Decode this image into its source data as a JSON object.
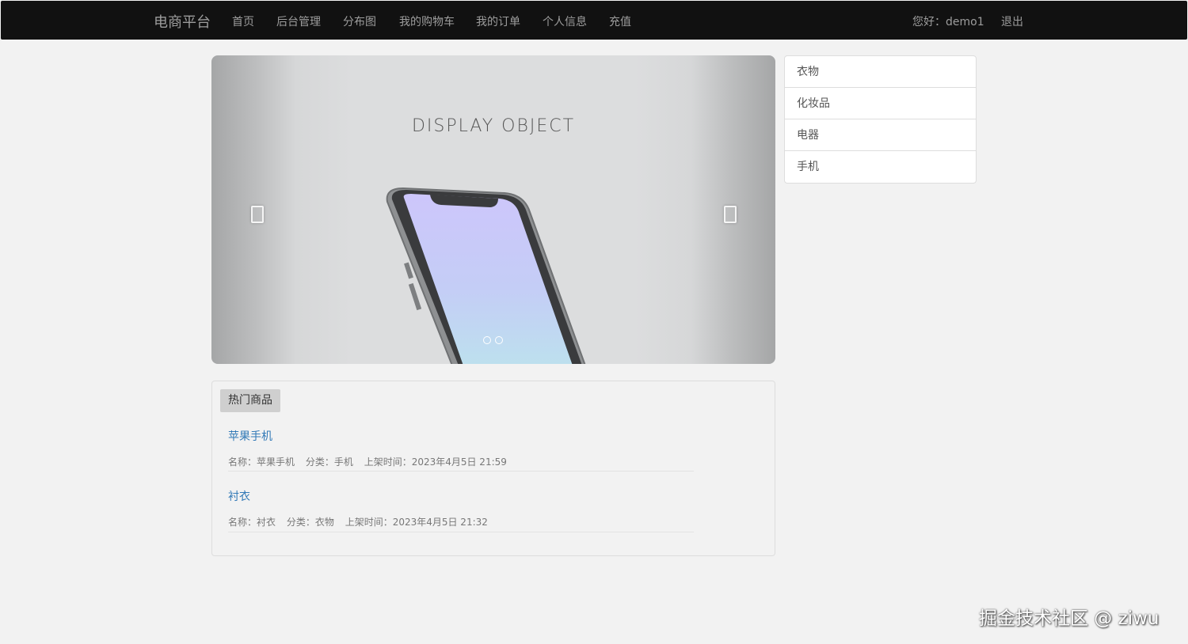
{
  "navbar": {
    "brand": "电商平台",
    "items": [
      {
        "label": "首页"
      },
      {
        "label": "后台管理"
      },
      {
        "label": "分布图"
      },
      {
        "label": "我的购物车"
      },
      {
        "label": "我的订单"
      },
      {
        "label": "个人信息"
      },
      {
        "label": "充值"
      }
    ],
    "greeting": "您好：demo1",
    "logout": "退出"
  },
  "carousel": {
    "caption": "DISPLAY OBJECT",
    "slide_count": 2
  },
  "categories": [
    {
      "label": "衣物"
    },
    {
      "label": "化妆品"
    },
    {
      "label": "电器"
    },
    {
      "label": "手机"
    }
  ],
  "hot_products": {
    "heading": "热门商品",
    "items": [
      {
        "title": "苹果手机",
        "name": "名称：苹果手机",
        "category": "分类：手机",
        "listed": "上架时间：2023年4月5日 21:59"
      },
      {
        "title": "衬衣",
        "name": "名称：衬衣",
        "category": "分类：衣物",
        "listed": "上架时间：2023年4月5日 21:32"
      }
    ]
  },
  "watermark": "掘金技术社区 @ ziwu"
}
